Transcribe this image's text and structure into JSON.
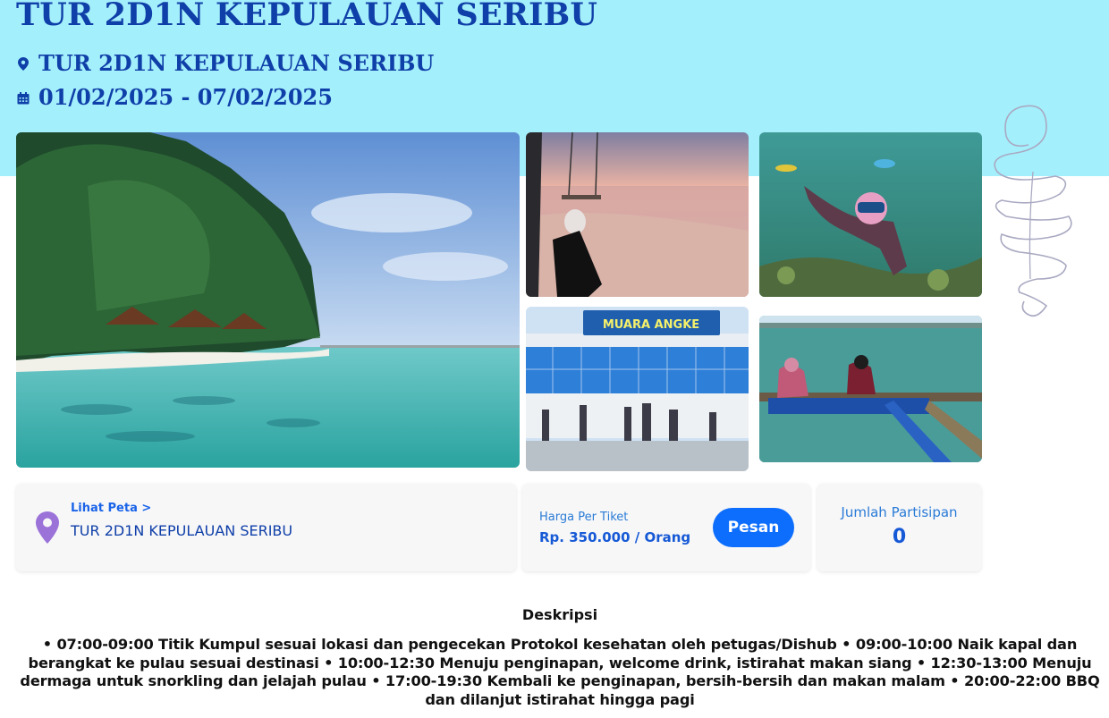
{
  "header": {
    "title": "TUR 2D1N KEPULAUAN SERIBU",
    "location": "TUR 2D1N KEPULAUAN SERIBU",
    "date_range": "01/02/2025 - 07/02/2025",
    "location_icon": "map-pin-icon",
    "date_icon": "calendar-icon",
    "band_color": "#a4effc",
    "text_color": "#0f3fa8"
  },
  "gallery": {
    "photos": [
      {
        "name": "island-beach-photo",
        "sign": ""
      },
      {
        "name": "sunset-swing-photo",
        "sign": ""
      },
      {
        "name": "snorkeling-photo",
        "sign": ""
      },
      {
        "name": "harbor-photo",
        "sign": "MUARA ANGKE"
      },
      {
        "name": "boat-photo",
        "sign": ""
      }
    ]
  },
  "info": {
    "map_link": "Lihat Peta >",
    "location_name": "TUR 2D1N KEPULAUAN SERIBU",
    "price_label": "Harga Per Tiket",
    "price_value": "Rp. 350.000 / Orang",
    "book_button": "Pesan",
    "participants_label": "Jumlah Partisipan",
    "participants_count": "0",
    "accent_color": "#0d6efd",
    "pin_color": "#9b72d8"
  },
  "description": {
    "title": "Deskripsi",
    "body": "• 07:00-09:00 Titik Kumpul sesuai lokasi dan pengecekan Protokol kesehatan oleh petugas/Dishub • 09:00-10:00 Naik kapal dan berangkat ke pulau sesuai destinasi • 10:00-12:30 Menuju penginapan, welcome drink, istirahat makan siang • 12:30-13:00 Menuju dermaga untuk snorkling dan jelajah pulau • 17:00-19:30 Kembali ke penginapan, bersih-bersih dan makan malam • 20:00-22:00 BBQ dan dilanjut istirahat hingga pagi"
  }
}
